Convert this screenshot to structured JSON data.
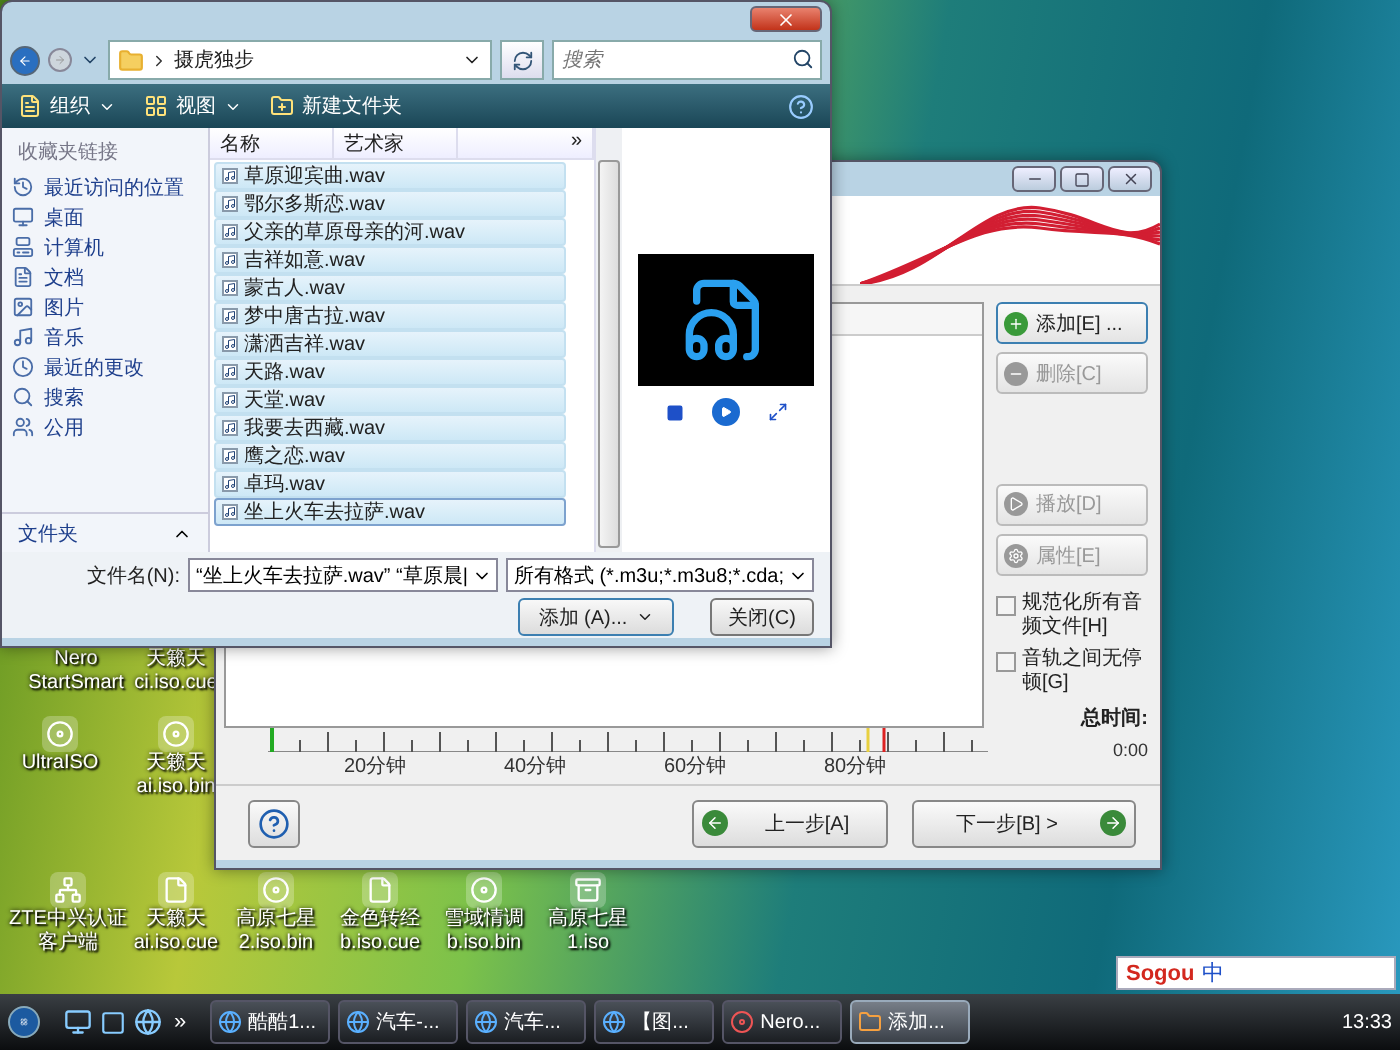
{
  "file_dialog": {
    "path": "摄虎独步",
    "search": {
      "placeholder": "搜索"
    },
    "toolbar": [
      {
        "label": "组织",
        "kind": "organize"
      },
      {
        "label": "视图",
        "kind": "views"
      },
      {
        "label": "新建文件夹",
        "kind": "folder"
      }
    ],
    "favorites_title": "收藏夹链接",
    "favorites": [
      {
        "label": "最近访问的位置",
        "kind": "recent"
      },
      {
        "label": "桌面",
        "kind": "desktop"
      },
      {
        "label": "计算机",
        "kind": "computer"
      },
      {
        "label": "文档",
        "kind": "documents"
      },
      {
        "label": "图片",
        "kind": "pictures"
      },
      {
        "label": "音乐",
        "kind": "music"
      },
      {
        "label": "最近的更改",
        "kind": "changes"
      },
      {
        "label": "搜索",
        "kind": "search"
      },
      {
        "label": "公用",
        "kind": "public"
      }
    ],
    "folders_label": "文件夹",
    "columns": [
      "名称",
      "艺术家",
      "»"
    ],
    "files": [
      {
        "name": "草原迎宾曲.wav",
        "selected": true
      },
      {
        "name": "鄂尔多斯恋.wav",
        "selected": true
      },
      {
        "name": "父亲的草原母亲的河.wav",
        "selected": true
      },
      {
        "name": "吉祥如意.wav",
        "selected": true
      },
      {
        "name": "蒙古人.wav",
        "selected": true
      },
      {
        "name": "梦中唐古拉.wav",
        "selected": true
      },
      {
        "name": "潇洒吉祥.wav",
        "selected": true
      },
      {
        "name": "天路.wav",
        "selected": true
      },
      {
        "name": "天堂.wav",
        "selected": true
      },
      {
        "name": "我要去西藏.wav",
        "selected": true
      },
      {
        "name": "鹰之恋.wav",
        "selected": true
      },
      {
        "name": "卓玛.wav",
        "selected": true
      },
      {
        "name": "坐上火车去拉萨.wav",
        "selected": true
      }
    ],
    "filename": {
      "label": "文件名(N):",
      "value": "“坐上火车去拉萨.wav” “草原晨|"
    },
    "filter": "所有格式 (*.m3u;*.m3u8;*.cda;",
    "add_button": "添加 (A)...",
    "close_button": "关闭(C)"
  },
  "burn_window": {
    "buttons": [
      {
        "label": "添加[E] ...",
        "kind": "add",
        "disabled": false
      },
      {
        "label": "删除[C]",
        "kind": "remove",
        "disabled": true
      },
      {
        "label": "播放[D]",
        "kind": "play",
        "disabled": true
      },
      {
        "label": "属性[E]",
        "kind": "properties",
        "disabled": true
      }
    ],
    "options": [
      {
        "label": "规范化所有音频文件[H]",
        "checked": false
      },
      {
        "label": "音轨之间无停顿[G]",
        "checked": false
      }
    ],
    "total_time_label": "总时间:",
    "total_time": "0:00",
    "timeline_labels": [
      "20分钟",
      "40分钟",
      "60分钟",
      "80分钟"
    ],
    "back_button": "上一步[A]",
    "next_button": "下一步[B] >"
  },
  "desktop_icons": [
    {
      "lines": [
        "Nero",
        "StartSmart"
      ],
      "kind": "none"
    },
    {
      "lines": [
        "天籁天",
        "ci.iso.cue"
      ],
      "kind": "none"
    },
    {
      "lines": [
        "UltraISO"
      ],
      "kind": "disc"
    },
    {
      "lines": [
        "天籁天",
        "ai.iso.bin"
      ],
      "kind": "disc"
    },
    {
      "lines": [
        "ZTE中兴认证",
        "客户端"
      ],
      "kind": "network"
    },
    {
      "lines": [
        "天籁天",
        "ai.iso.cue"
      ],
      "kind": "file"
    },
    {
      "lines": [
        "高原七星",
        "2.iso.bin"
      ],
      "kind": "disc"
    },
    {
      "lines": [
        "金色转经",
        "b.iso.cue"
      ],
      "kind": "file"
    },
    {
      "lines": [
        "雪域情调",
        "b.iso.bin"
      ],
      "kind": "disc"
    },
    {
      "lines": [
        "高原七星",
        "1.iso"
      ],
      "kind": "archive"
    }
  ],
  "ime_bar": {
    "logo": "Sogou",
    "mode": "中"
  },
  "taskbar": {
    "tasks": [
      {
        "label": "酷酷1...",
        "kind": "ie",
        "selected": false
      },
      {
        "label": "汽车-...",
        "kind": "ie",
        "selected": false
      },
      {
        "label": "汽车...",
        "kind": "ie",
        "selected": false
      },
      {
        "label": "【图...",
        "kind": "ie",
        "selected": false
      },
      {
        "label": "Nero...",
        "kind": "nero",
        "selected": false
      },
      {
        "label": "添加...",
        "kind": "app",
        "selected": true
      }
    ],
    "more": "»",
    "clock": "13:33"
  }
}
